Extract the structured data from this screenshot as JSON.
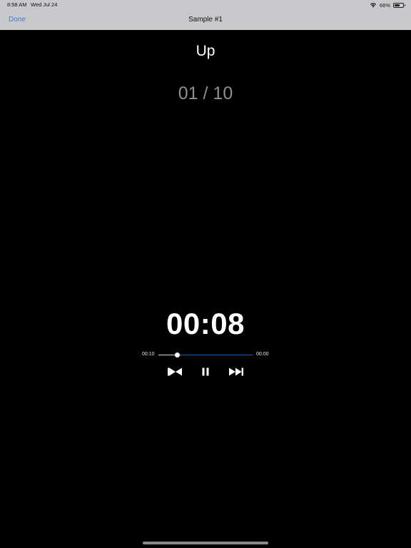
{
  "status_bar": {
    "time": "8:58 AM",
    "date": "Wed Jul 24",
    "battery_text": "66%",
    "battery_level": 0.66,
    "wifi_icon": "wifi-icon",
    "battery_icon": "battery-icon"
  },
  "nav": {
    "done_label": "Done",
    "title": "Sample #1",
    "accent_color": "#2f7fe0"
  },
  "main": {
    "title": "Up",
    "counter": "01 / 10",
    "timer": "00:08"
  },
  "player": {
    "time_left": "00:10",
    "time_right": "00:00",
    "progress": 0.2,
    "played_color": "#dcdcdc",
    "remaining_color": "#1e62c6",
    "controls": {
      "previous_icon": "skip-back-icon",
      "pause_icon": "pause-icon",
      "next_icon": "skip-forward-icon"
    }
  }
}
